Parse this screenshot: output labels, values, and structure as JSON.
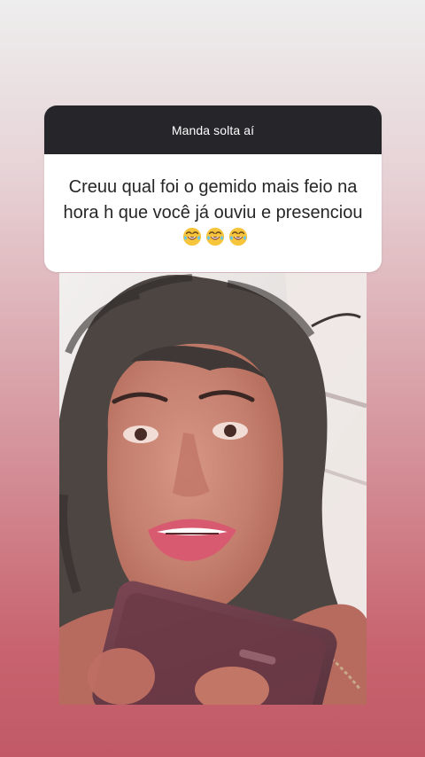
{
  "story": {
    "question_card": {
      "prompt_label": "Manda solta aí",
      "question_text": "Creuu qual foi o gemido mais feio na hora h que você já ouviu e presenciou",
      "emojis": [
        "😂",
        "😂",
        "😂"
      ],
      "header_color": "#26262a",
      "card_color": "#ffffff"
    },
    "media": {
      "icon": "selfie-photo",
      "background_gradient": [
        "#eeeeee",
        "#c15a66"
      ]
    }
  }
}
